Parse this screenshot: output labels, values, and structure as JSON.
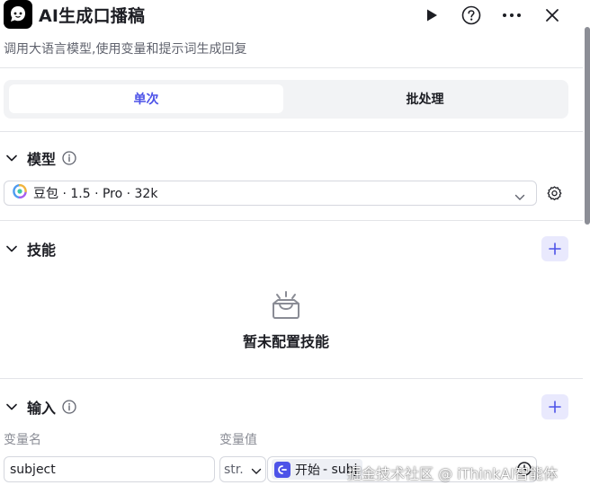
{
  "header": {
    "title": "AI生成口播稿",
    "subtitle": "调用大语言模型,使用变量和提示词生成回复",
    "icons": [
      "robot-icon",
      "play-icon",
      "help-icon",
      "more-icon",
      "close-icon"
    ]
  },
  "tabs": [
    {
      "label": "单次",
      "active": true
    },
    {
      "label": "批处理",
      "active": false
    }
  ],
  "model_section": {
    "title": "模型",
    "selected_model": "豆包 · 1.5 · Pro · 32k"
  },
  "skills_section": {
    "title": "技能",
    "empty_text": "暂未配置技能"
  },
  "input_section": {
    "title": "输入",
    "col_name_label": "变量名",
    "col_value_label": "变量值",
    "row": {
      "name_value": "subject",
      "type_value": "str.",
      "ref_node": "开始",
      "ref_var": "- subj"
    }
  },
  "watermark": "掘金技术社区 @ iThinkAI智能体",
  "colors": {
    "accent": "#4d53e8",
    "accent_light": "#e9e9fd",
    "border": "#d5d7de",
    "text": "#1c1d23",
    "muted": "#60636e"
  }
}
